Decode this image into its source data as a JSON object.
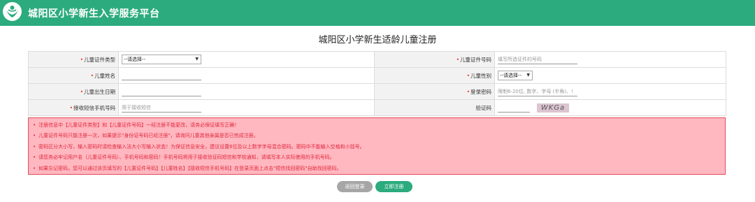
{
  "header": {
    "site_title": "城阳区小学新生入学服务平台",
    "color": "#2bab7e"
  },
  "page_title": "城阳区小学新生适龄儿童注册",
  "form": {
    "id_type": {
      "label": "儿童证件类型",
      "value": "--请选择--"
    },
    "id_number": {
      "label": "儿童证件号码",
      "placeholder": "填写所选证件的号码"
    },
    "name": {
      "label": "儿童姓名",
      "value": ""
    },
    "gender": {
      "label": "儿童性别",
      "value": "--请选择--"
    },
    "birthdate": {
      "label": "儿童出生日期",
      "value": ""
    },
    "password": {
      "label": "登录密码",
      "placeholder": "限制6-20位, 数字、字母 (半角)、!"
    },
    "phone": {
      "label": "接收短信手机号码",
      "placeholder": "用于接收短信"
    },
    "captcha": {
      "label": "验证码",
      "value": "",
      "image_text": "WKGa"
    }
  },
  "notices": [
    "注册信息中【儿童证件类型】和【儿童证件号码】一经注册不能更改，请务必保证填写正确！",
    "儿童证件号码只能注册一次，如果提示\"身份证号码已经注册\"，请询问儿童其他亲属是否已完成注册。",
    "密码区分大小写，输入密码时请检查输入法大小写输入状态！为保证信息安全，建议设置6位及以上数字字母混合密码。密码中不能输入空格和小括号。",
    "请您务必牢记用户名（儿童证件号码）、手机号码和密码！手机号码将用于接收验证码短信和学校通知，请填写本人实际使用的手机号码。",
    "如果忘记密码，您可以通过该页填写的【儿童证件号码】【儿童姓名】【接收短信手机号码】在登录页面上点击\"短信找回密码\"自助找回密码。"
  ],
  "buttons": {
    "back": "返回登录",
    "register": "立即注册"
  },
  "colors": {
    "accent": "#2bab7e",
    "notice_bg": "#ffb7c0",
    "notice_text": "#e0283c",
    "required_mark": "#e33"
  }
}
